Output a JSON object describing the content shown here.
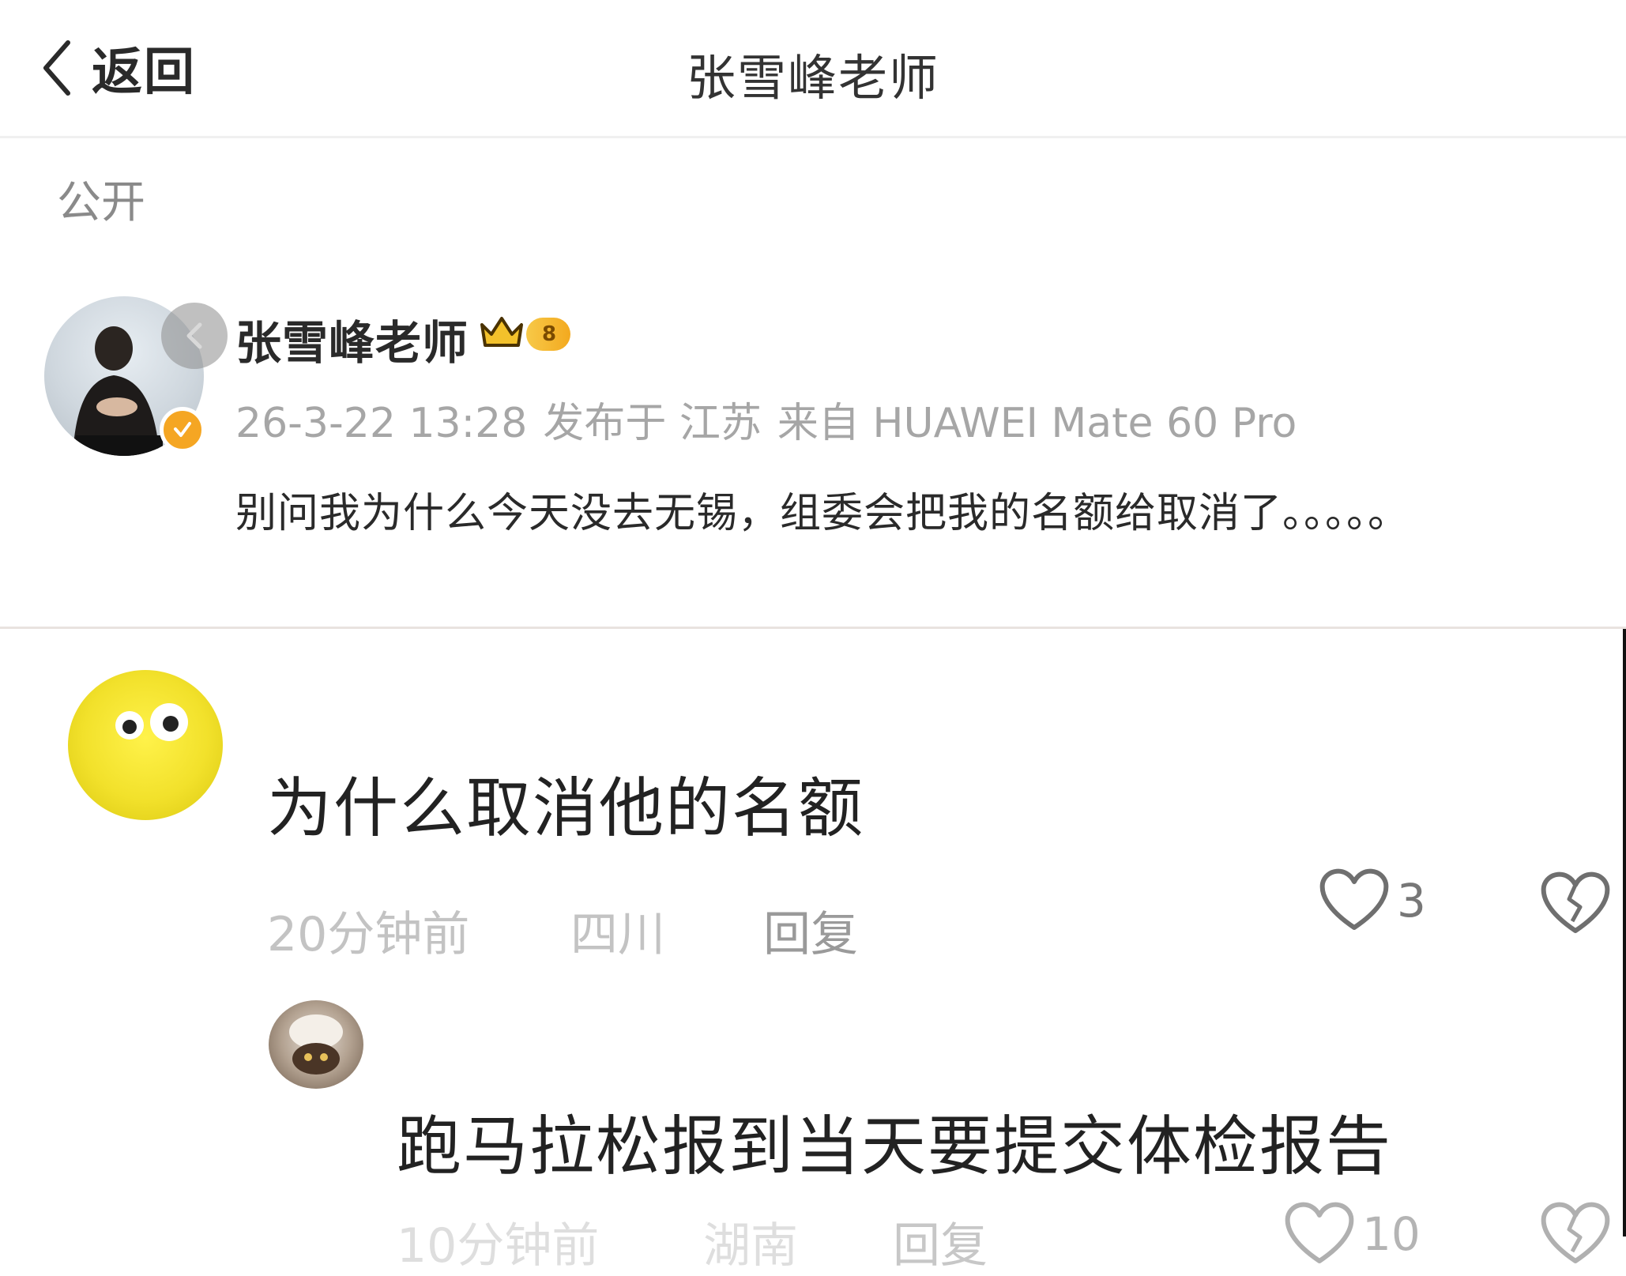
{
  "nav": {
    "back_label": "返回",
    "title": "张雪峰老师"
  },
  "post": {
    "visibility": "公开",
    "author": "张雪峰老师",
    "level_badge": "8",
    "date": "26-3-22 13:28",
    "location": "发布于 江苏",
    "source": "来自 HUAWEI Mate 60 Pro",
    "text": "别问我为什么今天没去无锡，组委会把我的名额给取消了。。。。。"
  },
  "comments": [
    {
      "text": "为什么取消他的名额",
      "time": "20分钟前",
      "location": "四川",
      "reply_label": "回复",
      "likes": "3"
    },
    {
      "text": "跑马拉松报到当天要提交体检报告",
      "time": "10分钟前",
      "location": "湖南",
      "reply_label": "回复",
      "likes": "10"
    }
  ],
  "colors": {
    "accent_gold": "#f5a623",
    "text_primary": "#222222",
    "text_muted": "#a6a6a6"
  },
  "icons": {
    "back": "chevron-left-icon",
    "verified": "verified-badge-icon",
    "crown": "crown-icon",
    "like": "heart-icon",
    "dislike": "broken-heart-icon"
  }
}
